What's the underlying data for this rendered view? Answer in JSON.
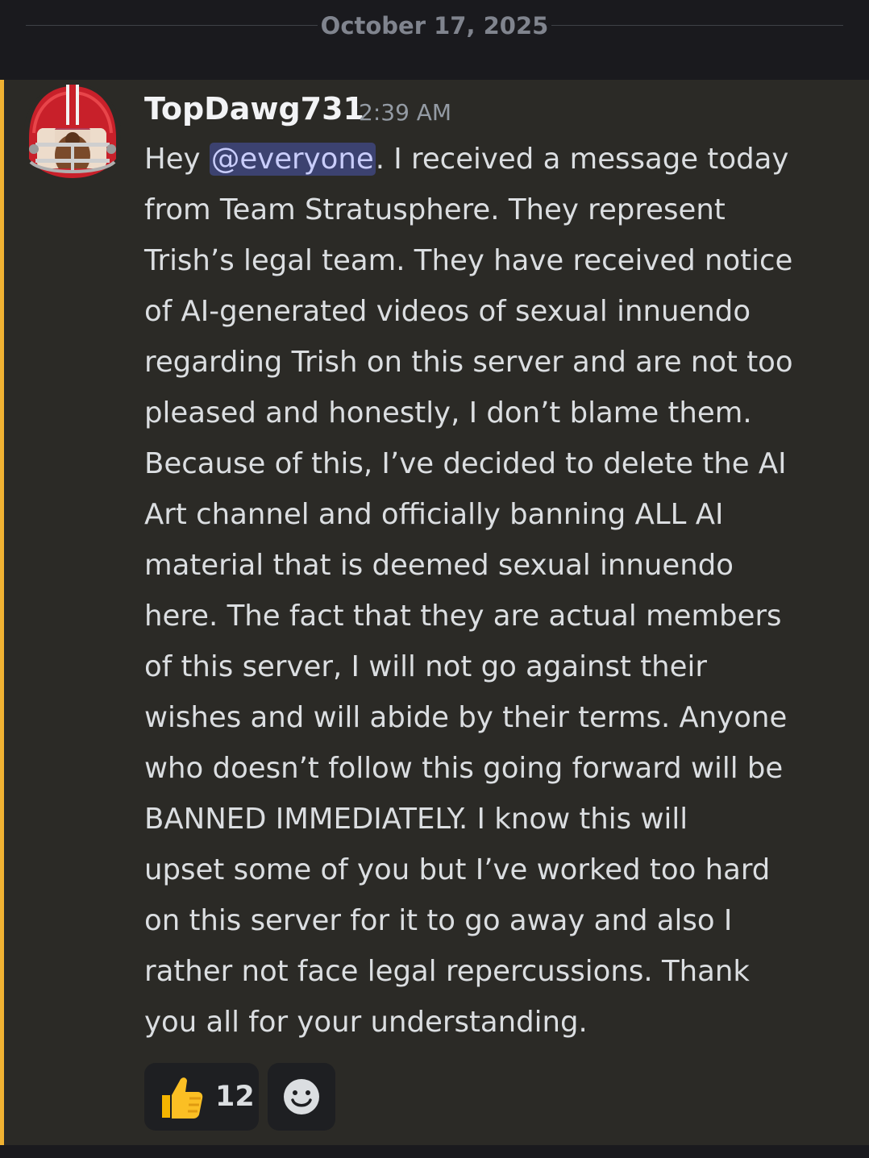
{
  "divider": {
    "date": "October 17, 2025"
  },
  "message": {
    "username": "TopDawg731",
    "timestamp": "2:39 AM",
    "greeting": "Hey ",
    "mention": "@everyone",
    "first_line_rest": ". I received a message today",
    "lines": [
      "from Team Stratusphere. They represent",
      "Trish’s legal team. They have received notice",
      "of AI-generated videos of sexual innuendo",
      "regarding Trish on this server and are not too",
      "pleased and honestly, I don’t blame them.",
      "Because of this, I’ve decided to delete the AI",
      "Art channel and officially banning ALL AI",
      "material that is deemed sexual innuendo",
      "here. The fact that they are actual members",
      "of this server, I will not go against their",
      "wishes and will abide by their terms. Anyone",
      "who doesn’t follow this going forward will be",
      "BANNED IMMEDIATELY. I know this will",
      "upset some of you but I’ve worked too hard",
      "on this server for it to go away and also I",
      "rather not face legal repercussions. Thank",
      "you all for your understanding."
    ],
    "highlight_color": "#f0b232",
    "mention_color": "#c9cdfb"
  },
  "reactions": [
    {
      "icon": "thumbs-up-icon",
      "count": "12"
    },
    {
      "icon": "add-reaction-icon"
    }
  ]
}
